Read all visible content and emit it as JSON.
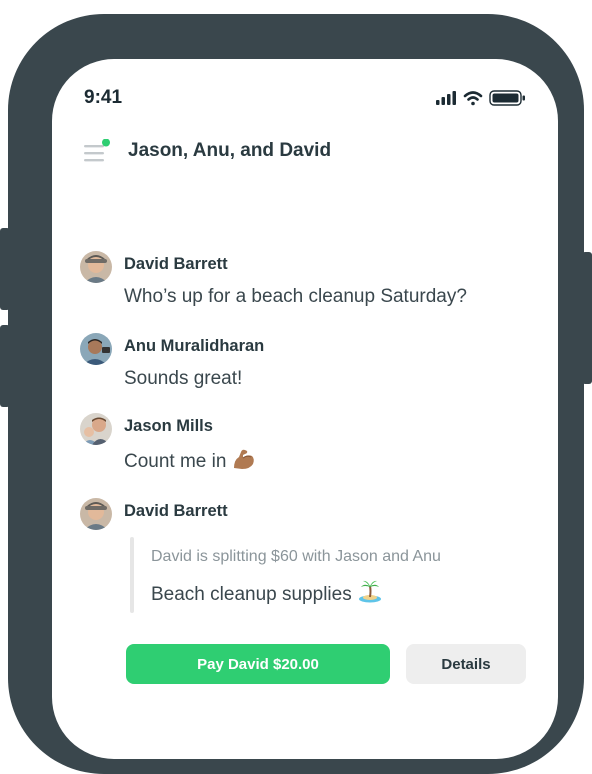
{
  "status_bar": {
    "time": "9:41",
    "signal_icon": "cellular-signal-icon",
    "wifi_icon": "wifi-icon",
    "battery_icon": "battery-icon"
  },
  "header": {
    "menu_icon": "hamburger-menu-icon",
    "title": "Jason, Anu, and David",
    "unread_indicator_color": "#2fce72"
  },
  "messages": [
    {
      "sender": "David Barrett",
      "text": "Who’s up for a beach cleanup Saturday?",
      "avatar": "david-avatar"
    },
    {
      "sender": "Anu Muralidharan",
      "text": "Sounds great!",
      "avatar": "anu-avatar"
    },
    {
      "sender": "Jason Mills",
      "text": "Count me in",
      "emoji": "flexed-biceps-icon",
      "avatar": "jason-avatar"
    },
    {
      "sender": "David Barrett",
      "avatar": "david-avatar"
    }
  ],
  "split_request": {
    "note": "David is splitting $60 with Jason and Anu",
    "title": "Beach cleanup supplies",
    "emoji": "desert-island-icon",
    "pay_label": "Pay David $20.00",
    "details_label": "Details"
  },
  "colors": {
    "frame": "#3a474d",
    "accent_green": "#2fce72",
    "text_dark": "#2a3a40",
    "text_muted": "#8b959a"
  }
}
